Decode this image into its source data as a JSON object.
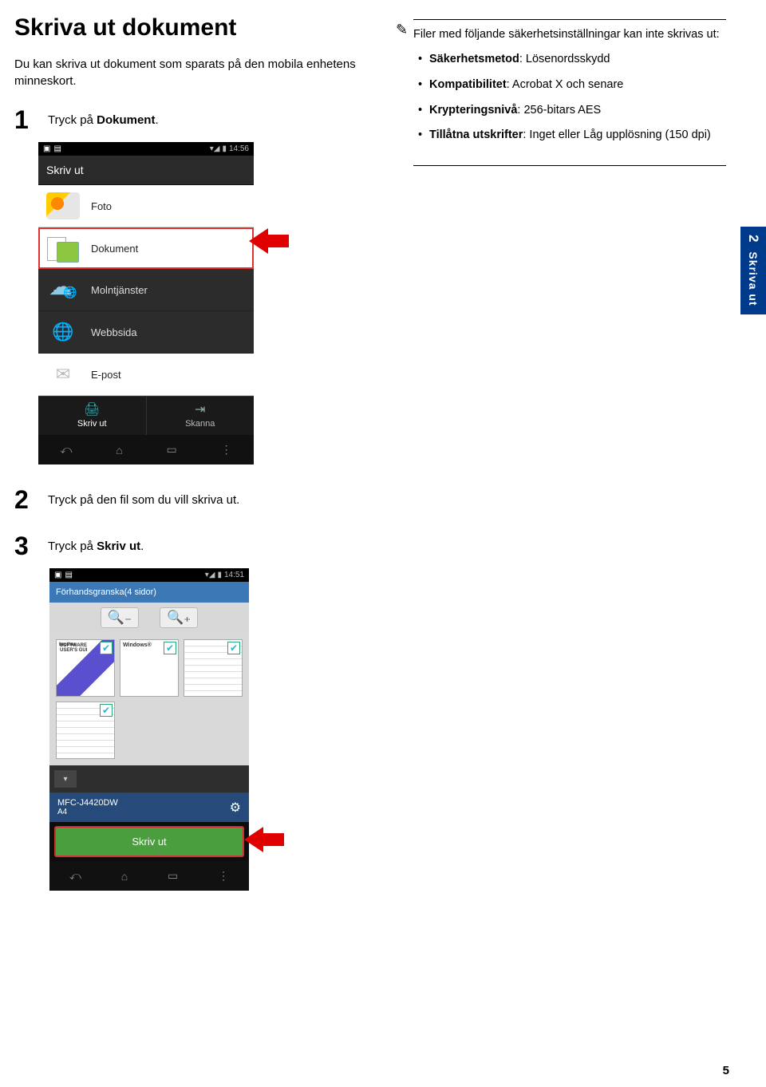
{
  "header": {
    "title": "Skriva ut dokument"
  },
  "intro": "Du kan skriva ut dokument som sparats på den mobila enhetens minneskort.",
  "steps": {
    "s1": {
      "num": "1",
      "text_pre": "Tryck på ",
      "text_bold": "Dokument",
      "text_post": "."
    },
    "s2": {
      "num": "2",
      "text_pre": "Tryck på den fil som du vill skriva ut."
    },
    "s3": {
      "num": "3",
      "text_pre": "Tryck på ",
      "text_bold": "Skriv ut",
      "text_post": "."
    }
  },
  "note": {
    "heading": "Filer med följande säkerhetsinställningar kan inte skrivas ut:",
    "items": {
      "a_pre": "Säkerhetsmetod",
      "a_post": ": Lösenordsskydd",
      "b_pre": "Kompatibilitet",
      "b_post": ": Acrobat X och senare",
      "c_pre": "Krypteringsnivå",
      "c_post": ": 256-bitars AES",
      "d_pre": "Tillåtna utskrifter",
      "d_post": ": Inget eller Låg upplösning (150 dpi)"
    }
  },
  "sidetab": {
    "num": "2",
    "label": "Skriva ut"
  },
  "pagenum": "5",
  "phone1": {
    "time": "14:56",
    "title": "Skriv ut",
    "items": {
      "foto": "Foto",
      "dokument": "Dokument",
      "moln": "Molntjänster",
      "webb": "Webbsida",
      "epost": "E-post"
    },
    "tab_print": "Skriv ut",
    "tab_scan": "Skanna"
  },
  "phone2": {
    "time": "14:51",
    "header": "Förhandsgranska(4 sidor)",
    "device": "MFC-J4420DW",
    "paper": "A4",
    "print_btn": "Skriv ut"
  }
}
